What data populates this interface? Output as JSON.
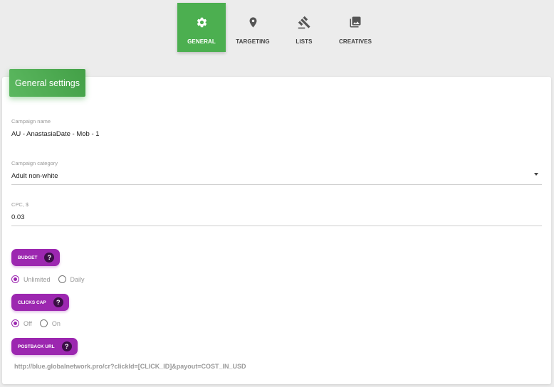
{
  "tabs": [
    {
      "label": "GENERAL",
      "icon": "gear-icon",
      "active": true
    },
    {
      "label": "TARGETING",
      "icon": "location-pin-icon",
      "active": false
    },
    {
      "label": "LISTS",
      "icon": "gavel-icon",
      "active": false
    },
    {
      "label": "CREATIVES",
      "icon": "image-icon",
      "active": false
    }
  ],
  "card": {
    "header": "General settings"
  },
  "campaign_name": {
    "label": "Campaign name",
    "value": "AU - AnastasiaDate -  Mob - 1"
  },
  "campaign_category": {
    "label": "Campaign category",
    "value": "Adult non-white"
  },
  "cpc": {
    "label": "CPC, $",
    "value": "0.03"
  },
  "budget": {
    "label": "BUDGET",
    "options": [
      {
        "label": "Unlimited",
        "checked": true
      },
      {
        "label": "Daily",
        "checked": false
      }
    ]
  },
  "clicks_cap": {
    "label": "CLICKS CAP",
    "options": [
      {
        "label": "Off",
        "checked": true
      },
      {
        "label": "On",
        "checked": false
      }
    ]
  },
  "postback": {
    "label": "POSTBACK URL",
    "url": "http://blue.globalnetwork.pro/cr?clickId=[CLICK_ID]&payout=COST_IN_USD"
  },
  "colors": {
    "accent_green": "#4caf50",
    "accent_purple": "#9c27b0"
  }
}
